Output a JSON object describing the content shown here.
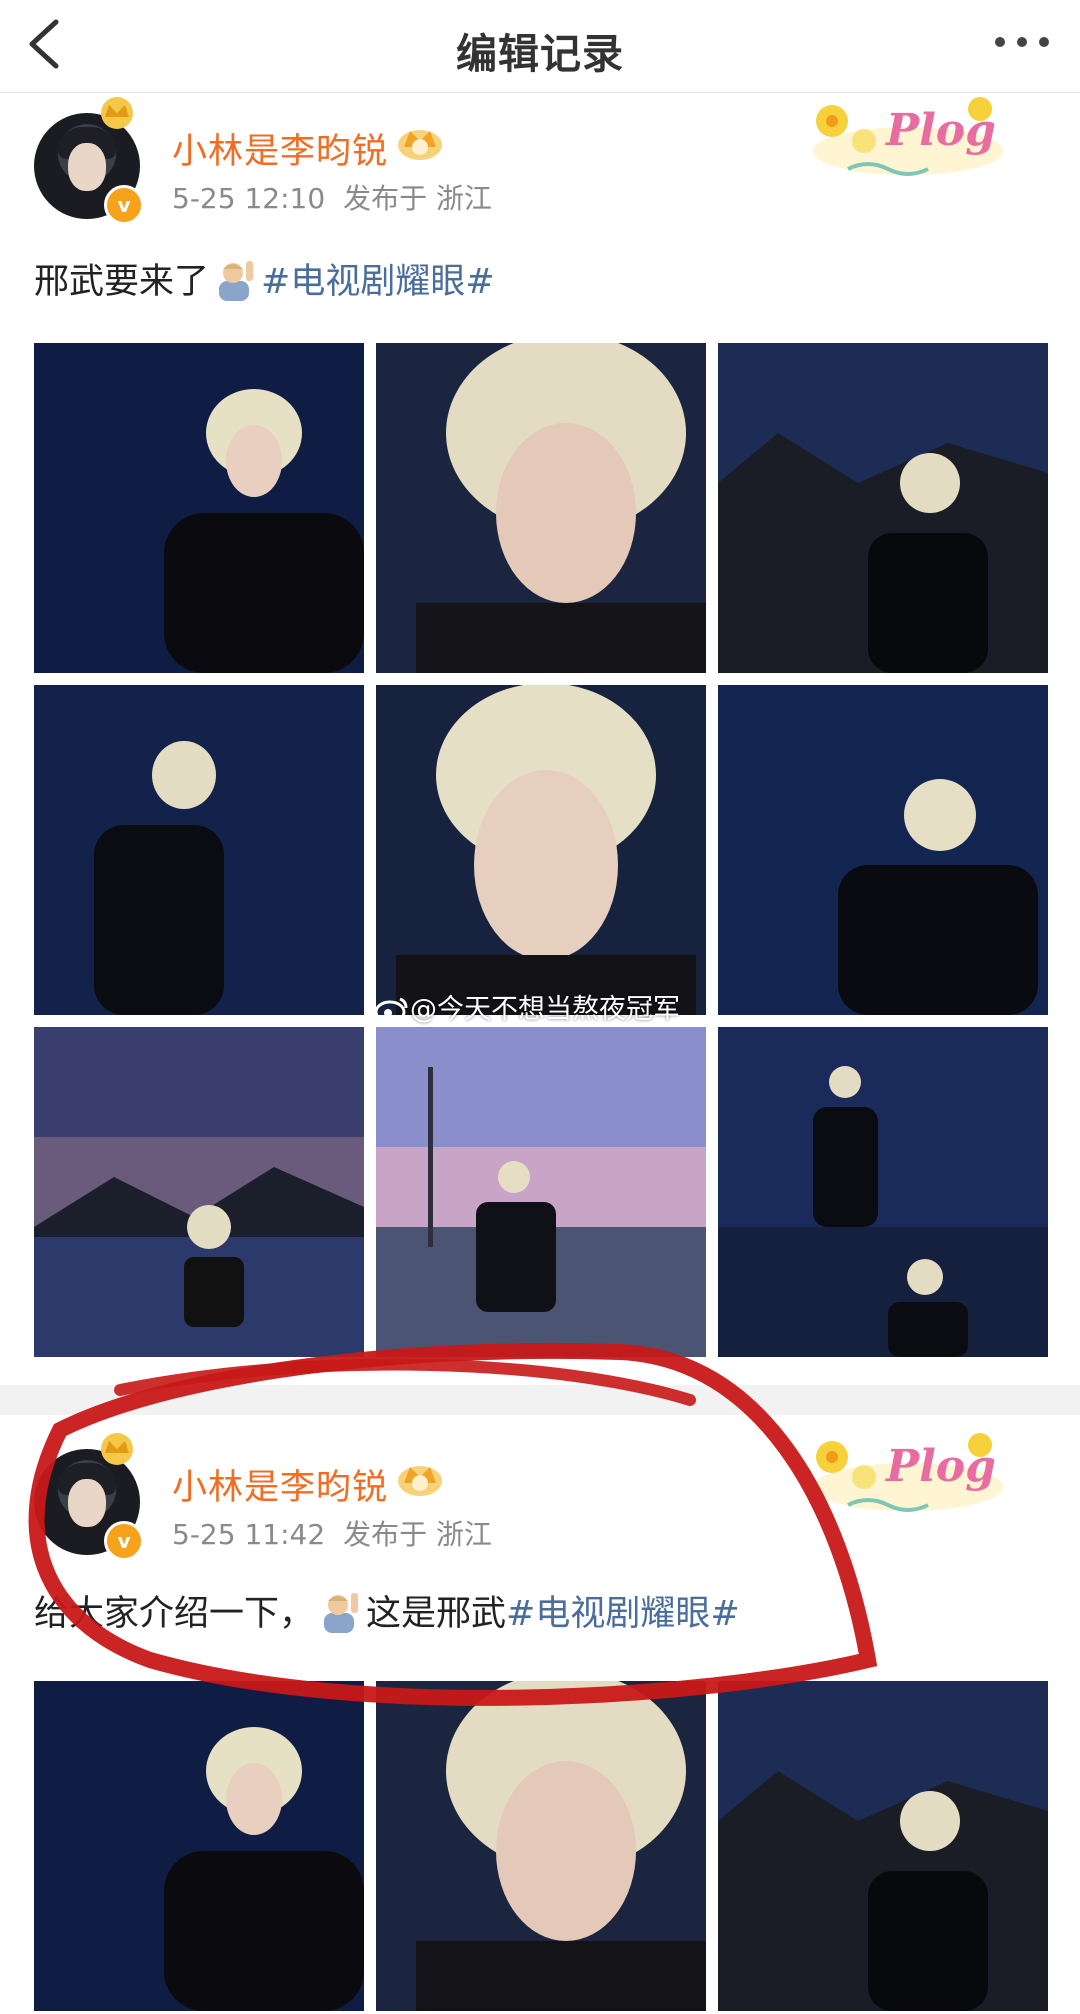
{
  "header": {
    "title": "编辑记录",
    "back_icon": "chevron-left-icon",
    "more_icon": "more-dots-icon"
  },
  "posts": [
    {
      "username": "小林是李昀锐",
      "time": "5-25 12:10",
      "location": "发布于 浙江",
      "text": "邢武要来了",
      "hashtag": "#电视剧耀眼#",
      "sticker_text": "Plog",
      "photo_count": 9
    },
    {
      "username": "小林是李昀锐",
      "time": "5-25 11:42",
      "location": "发布于 浙江",
      "text_before": "给大家介绍一下，",
      "text_after": "这是邢武",
      "hashtag": "#电视剧耀眼#",
      "sticker_text": "Plog",
      "photo_count": 3
    }
  ],
  "watermark": "@今天不想当熬夜冠军",
  "badge": {
    "letter": "v"
  },
  "colors": {
    "username": "#f26d21",
    "hashtag": "#4a6d9c",
    "annotation": "#c81818",
    "badge": "#f7a21b"
  }
}
